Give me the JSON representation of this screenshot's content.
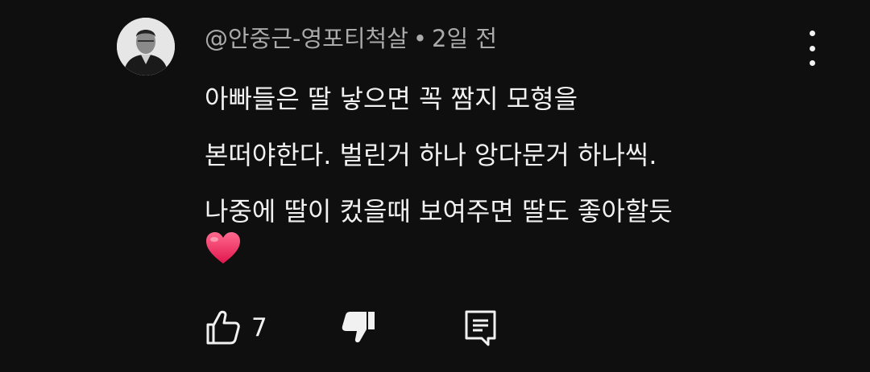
{
  "comment": {
    "author": "@안중근-영포티척살",
    "separator": "•",
    "timestamp": "2일 전",
    "lines": [
      "아빠들은 딸 낳으면 꼭 짬지 모형을",
      "본떠야한다. 벌린거 하나 앙다문거 하나씩.",
      "나중에 딸이 컸을때 보여주면 딸도 좋아할듯"
    ],
    "emoji": "heart-emoji",
    "like_count": "7"
  },
  "colors": {
    "background": "#0f0f0f",
    "text": "#f1f1f1",
    "meta": "#aaaaaa",
    "heart": "#ff3b6b"
  },
  "icons": {
    "menu": "more-vert-icon",
    "like": "thumbs-up-icon",
    "dislike": "thumbs-down-icon",
    "reply": "reply-comment-icon"
  }
}
